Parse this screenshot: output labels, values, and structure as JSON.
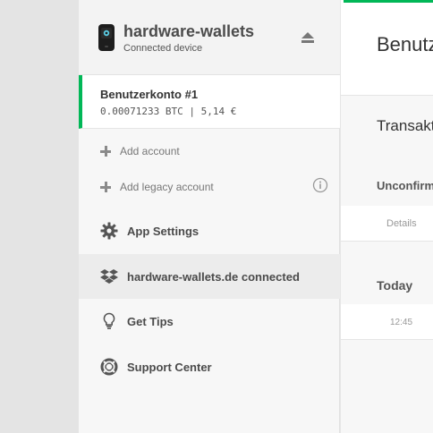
{
  "device": {
    "name": "hardware-wallets",
    "status": "Connected device"
  },
  "account": {
    "name": "Benutzerkonto #1",
    "balance": "0.00071233 BTC | 5,14 €"
  },
  "actions": {
    "add_account": "Add account",
    "add_legacy_account": "Add legacy account"
  },
  "menu": {
    "app_settings": "App Settings",
    "connected": "hardware-wallets.de connected",
    "get_tips": "Get Tips",
    "support_center": "Support Center"
  },
  "main": {
    "title": "Benutz",
    "section": "Transakt",
    "unconfirmed": "Unconfirm",
    "details": "Details",
    "today": "Today",
    "time": "12:45"
  },
  "colors": {
    "accent": "#01b757"
  }
}
